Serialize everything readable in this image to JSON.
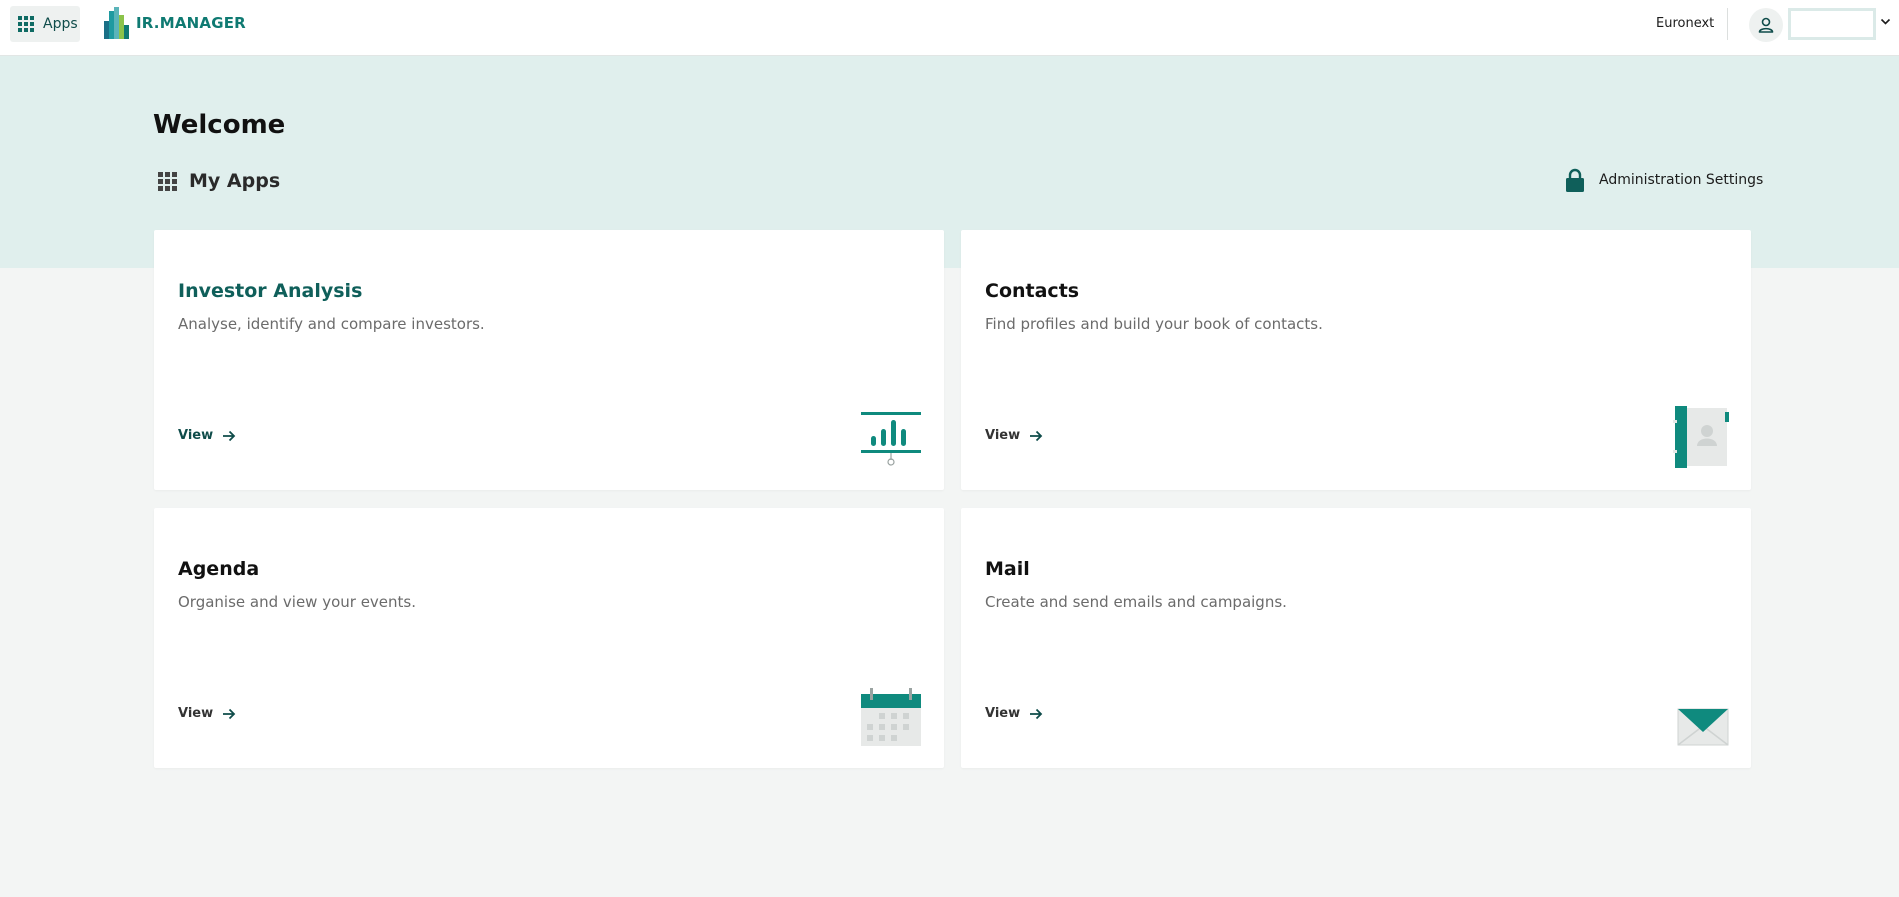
{
  "header": {
    "apps_label": "Apps",
    "logo_text": "IR.MANAGER",
    "tenant": "Euronext",
    "user_select_value": ""
  },
  "hero": {
    "welcome": "Welcome",
    "my_apps": "My Apps",
    "admin_settings": "Administration Settings"
  },
  "apps": [
    {
      "title": "Investor Analysis",
      "description": "Analyse, identify and compare investors.",
      "view_label": "View",
      "icon": "presentation-chart-icon"
    },
    {
      "title": "Contacts",
      "description": "Find profiles and build your book of contacts.",
      "view_label": "View",
      "icon": "address-book-icon"
    },
    {
      "title": "Agenda",
      "description": "Organise and view your events.",
      "view_label": "View",
      "icon": "calendar-icon"
    },
    {
      "title": "Mail",
      "description": "Create and send emails and campaigns.",
      "view_label": "View",
      "icon": "envelope-icon"
    }
  ],
  "colors": {
    "brand_teal": "#0f8a7e",
    "dark_teal": "#0f5f5a",
    "hero_background": "#e0efed",
    "page_background": "#f3f5f4"
  }
}
